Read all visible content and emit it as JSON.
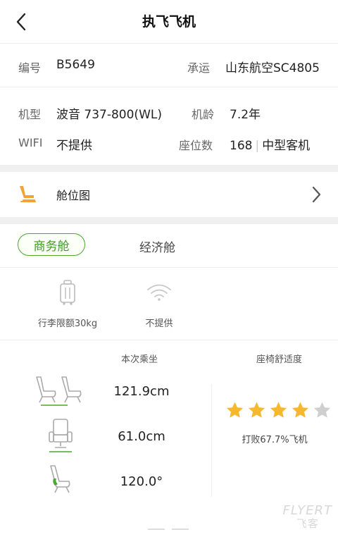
{
  "header": {
    "title": "执飞飞机"
  },
  "info": {
    "code_label": "编号",
    "code_value": "B5649",
    "carrier_label": "承运",
    "carrier_value": "山东航空SC4805",
    "model_label": "机型",
    "model_value": "波音 737-800(WL)",
    "age_label": "机龄",
    "age_value": "7.2年",
    "wifi_label": "WIFI",
    "wifi_value": "不提供",
    "seats_label": "座位数",
    "seats_value": "168",
    "size_value": "中型客机"
  },
  "seatmap": {
    "label": "舱位图"
  },
  "tabs": [
    {
      "label": "商务舱"
    },
    {
      "label": "经济舱"
    }
  ],
  "amenities": [
    {
      "label": "行李限额30kg",
      "icon": "luggage-icon"
    },
    {
      "label": "不提供",
      "icon": "wifi-icon"
    }
  ],
  "comfort": {
    "col1_header": "本次乘坐",
    "col2_header": "座椅舒适度",
    "pitch": "121.9cm",
    "width": "61.0cm",
    "recline": "120.0°",
    "rating": 4,
    "rating_max": 5,
    "beat_text": "打败67.7%飞机"
  },
  "watermark": {
    "line1": "FLYERT",
    "line2": "飞客"
  },
  "colors": {
    "accent_green": "#4aa82a",
    "star_yellow": "#f5b82e",
    "star_gray": "#cfcfcf",
    "seat_orange": "#f3a23a"
  }
}
